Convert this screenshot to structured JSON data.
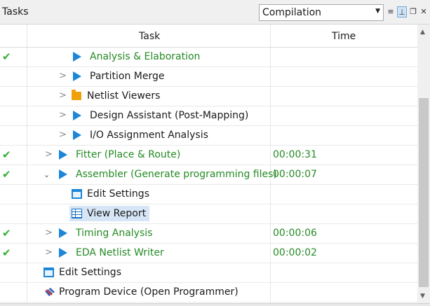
{
  "panel": {
    "title": "Tasks",
    "flow_select": {
      "value": "Compilation"
    },
    "toolbar_icons": [
      "list-icon",
      "pin-icon",
      "restore-icon",
      "close-icon"
    ]
  },
  "columns": {
    "task": "Task",
    "time": "Time"
  },
  "rows": [
    {
      "label": "Analysis & Elaboration",
      "time": "",
      "status": "done",
      "icon": "play-icon",
      "level": 2,
      "expander": "none"
    },
    {
      "label": "Partition Merge",
      "time": "",
      "status": "",
      "icon": "play-icon",
      "level": 2,
      "expander": "collapsed"
    },
    {
      "label": "Netlist Viewers",
      "time": "",
      "status": "",
      "icon": "folder-icon",
      "level": 2,
      "expander": "collapsed"
    },
    {
      "label": "Design Assistant (Post-Mapping)",
      "time": "",
      "status": "",
      "icon": "play-icon",
      "level": 2,
      "expander": "collapsed"
    },
    {
      "label": "I/O Assignment Analysis",
      "time": "",
      "status": "",
      "icon": "play-icon",
      "level": 2,
      "expander": "collapsed"
    },
    {
      "label": "Fitter (Place & Route)",
      "time": "00:00:31",
      "status": "done",
      "icon": "play-icon",
      "level": 1,
      "expander": "collapsed"
    },
    {
      "label": "Assembler (Generate programming files)",
      "time": "00:00:07",
      "status": "done",
      "icon": "play-icon",
      "level": 1,
      "expander": "expanded"
    },
    {
      "label": "Edit Settings",
      "time": "",
      "status": "",
      "icon": "settings-icon",
      "level": 2,
      "expander": "none"
    },
    {
      "label": "View Report",
      "time": "",
      "status": "",
      "icon": "report-icon",
      "level": 2,
      "expander": "none",
      "selected": true
    },
    {
      "label": "Timing Analysis",
      "time": "00:00:06",
      "status": "done",
      "icon": "play-icon",
      "level": 1,
      "expander": "collapsed"
    },
    {
      "label": "EDA Netlist Writer",
      "time": "00:00:02",
      "status": "done",
      "icon": "play-icon",
      "level": 1,
      "expander": "collapsed"
    },
    {
      "label": "Edit Settings",
      "time": "",
      "status": "",
      "icon": "settings-icon",
      "level": 0,
      "expander": "none"
    },
    {
      "label": "Program Device (Open Programmer)",
      "time": "",
      "status": "",
      "icon": "programmer-icon",
      "level": 0,
      "expander": "none"
    }
  ],
  "colors": {
    "done_text": "#248a24",
    "play_icon": "#1c86d8",
    "check": "#2fb02f",
    "folder": "#f0a10a",
    "selection": "#d6e6f7"
  }
}
